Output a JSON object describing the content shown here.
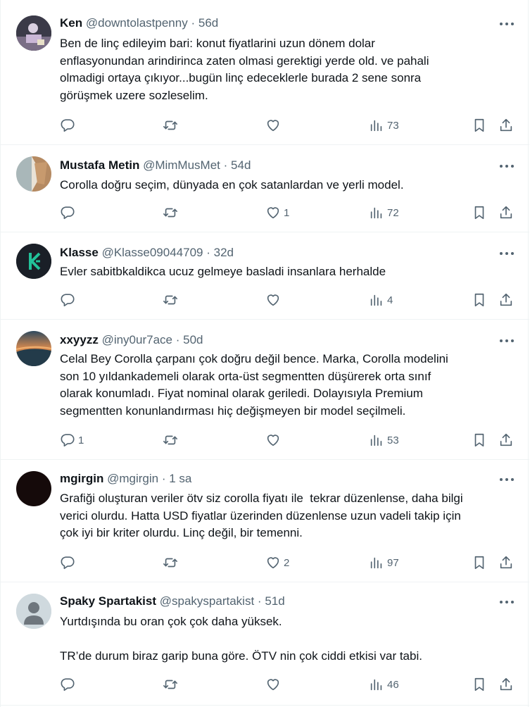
{
  "tweets": [
    {
      "name": "Ken",
      "handle": "@downtolastpenny",
      "dot": "·",
      "time": "56d",
      "text": "Ben de linç edileyim bari: konut fiyatlarini uzun dönem dolar\nenflasyonundan arindirinca zaten olmasi gerektigi yerde old. ve pahali\nolmadigi ortaya çıkıyor...bugün linç edeceklerle burada 2 sene sonra\ngörüşmek uzere sozleselim.",
      "replies": "",
      "likes": "",
      "views": "73",
      "avatar": "dark"
    },
    {
      "name": "Mustafa Metin",
      "handle": "@MimMusMet",
      "dot": "·",
      "time": "54d",
      "text": "Corolla doğru seçim, dünyada en çok satanlardan ve yerli model.",
      "replies": "",
      "likes": "1",
      "views": "72",
      "avatar": "beige"
    },
    {
      "name": "Klasse",
      "handle": "@Klasse09044709",
      "dot": "·",
      "time": "32d",
      "text": "Evler sabitbkaldikca ucuz gelmeye basladi insanlara herhalde",
      "replies": "",
      "likes": "",
      "views": "4",
      "avatar": "kc"
    },
    {
      "name": "xxyyzz",
      "handle": "@iny0ur7ace",
      "dot": "·",
      "time": "50d",
      "text": "Celal Bey Corolla çarpanı çok doğru değil bence. Marka, Corolla modelini\nson 10 yıldankademeli olarak orta-üst segmentten düşürerek orta sınıf\nolarak konumladı. Fiyat nominal olarak geriledi. Dolayısıyla Premium\nsegmentten konunlandırması hiç değişmeyen bir model seçilmeli.",
      "replies": "1",
      "likes": "",
      "views": "53",
      "avatar": "sunset"
    },
    {
      "name": "mgirgin",
      "handle": "@mgirgin",
      "dot": "·",
      "time": "1 sa",
      "text": "Grafiği oluşturan veriler ötv siz corolla fiyatı ile  tekrar düzenlense, daha bilgi\nverici olurdu. Hatta USD fiyatlar üzerinden düzenlense uzun vadeli takip için\nçok iyi bir kriter olurdu. Linç değil, bir temenni.",
      "replies": "",
      "likes": "2",
      "views": "97",
      "avatar": "black"
    },
    {
      "name": "Spaky Spartakist",
      "handle": "@spakyspartakist",
      "dot": "·",
      "time": "51d",
      "text": "Yurtdışında bu oran çok çok daha yüksek.\n\nTR’de durum biraz garip buna göre. ÖTV nin çok ciddi etkisi var tabi.",
      "replies": "",
      "likes": "",
      "views": "46",
      "avatar": "default"
    }
  ],
  "colors": {
    "text": "#0f1419",
    "secondary": "#536471",
    "border": "#eff3f4"
  }
}
